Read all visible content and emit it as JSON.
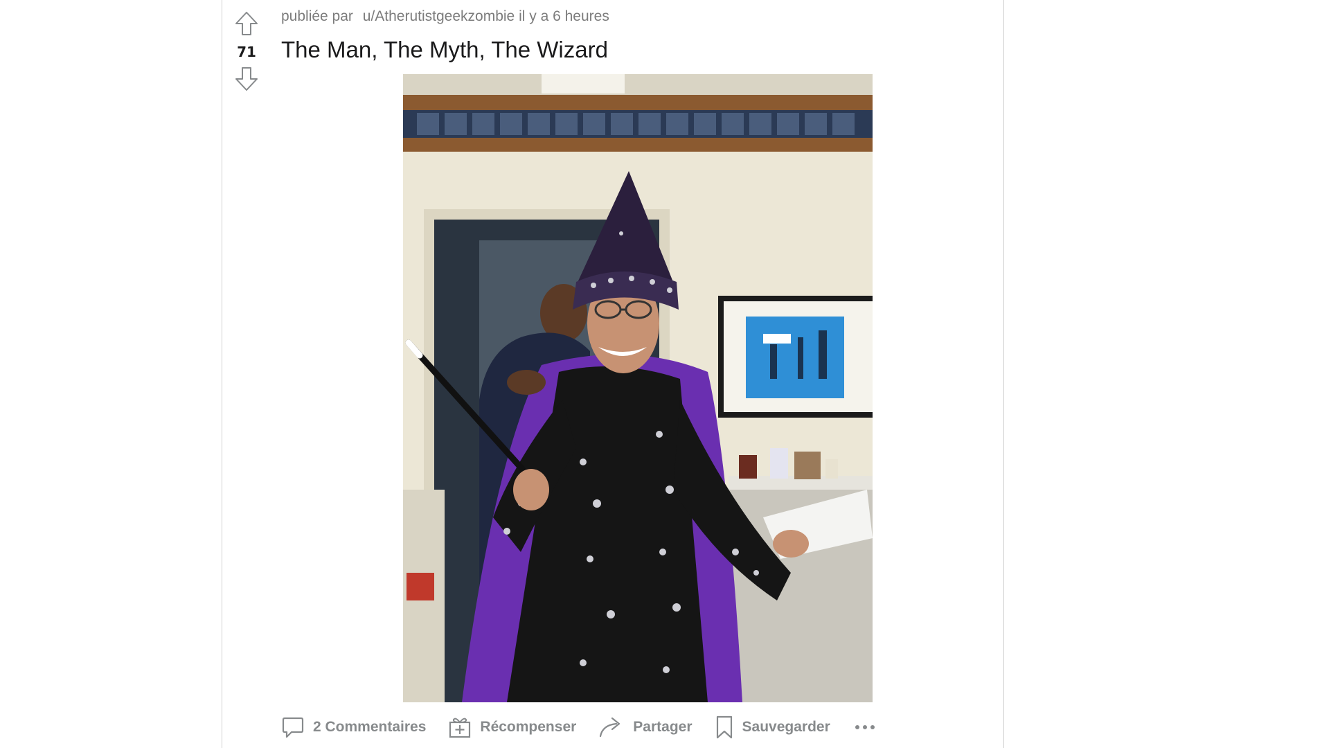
{
  "post": {
    "score": "71",
    "posted_by_prefix": "publiée par",
    "author": "u/Atherutistgeekzombie",
    "time_ago": "il y a 6 heures",
    "title": "The Man, The Myth, The Wizard"
  },
  "actions": {
    "comments_label": "2 Commentaires",
    "award_label": "Récompenser",
    "share_label": "Partager",
    "save_label": "Sauvegarder"
  },
  "icons": {
    "upvote": "arrow-up-icon",
    "downvote": "arrow-down-icon",
    "comments": "comment-bubble-icon",
    "award": "gift-icon",
    "share": "share-arrow-icon",
    "save": "bookmark-icon",
    "more": "more-options-icon"
  },
  "colors": {
    "text_primary": "#1a1a1b",
    "text_muted": "#878a8c",
    "border": "#cfcfcf"
  }
}
